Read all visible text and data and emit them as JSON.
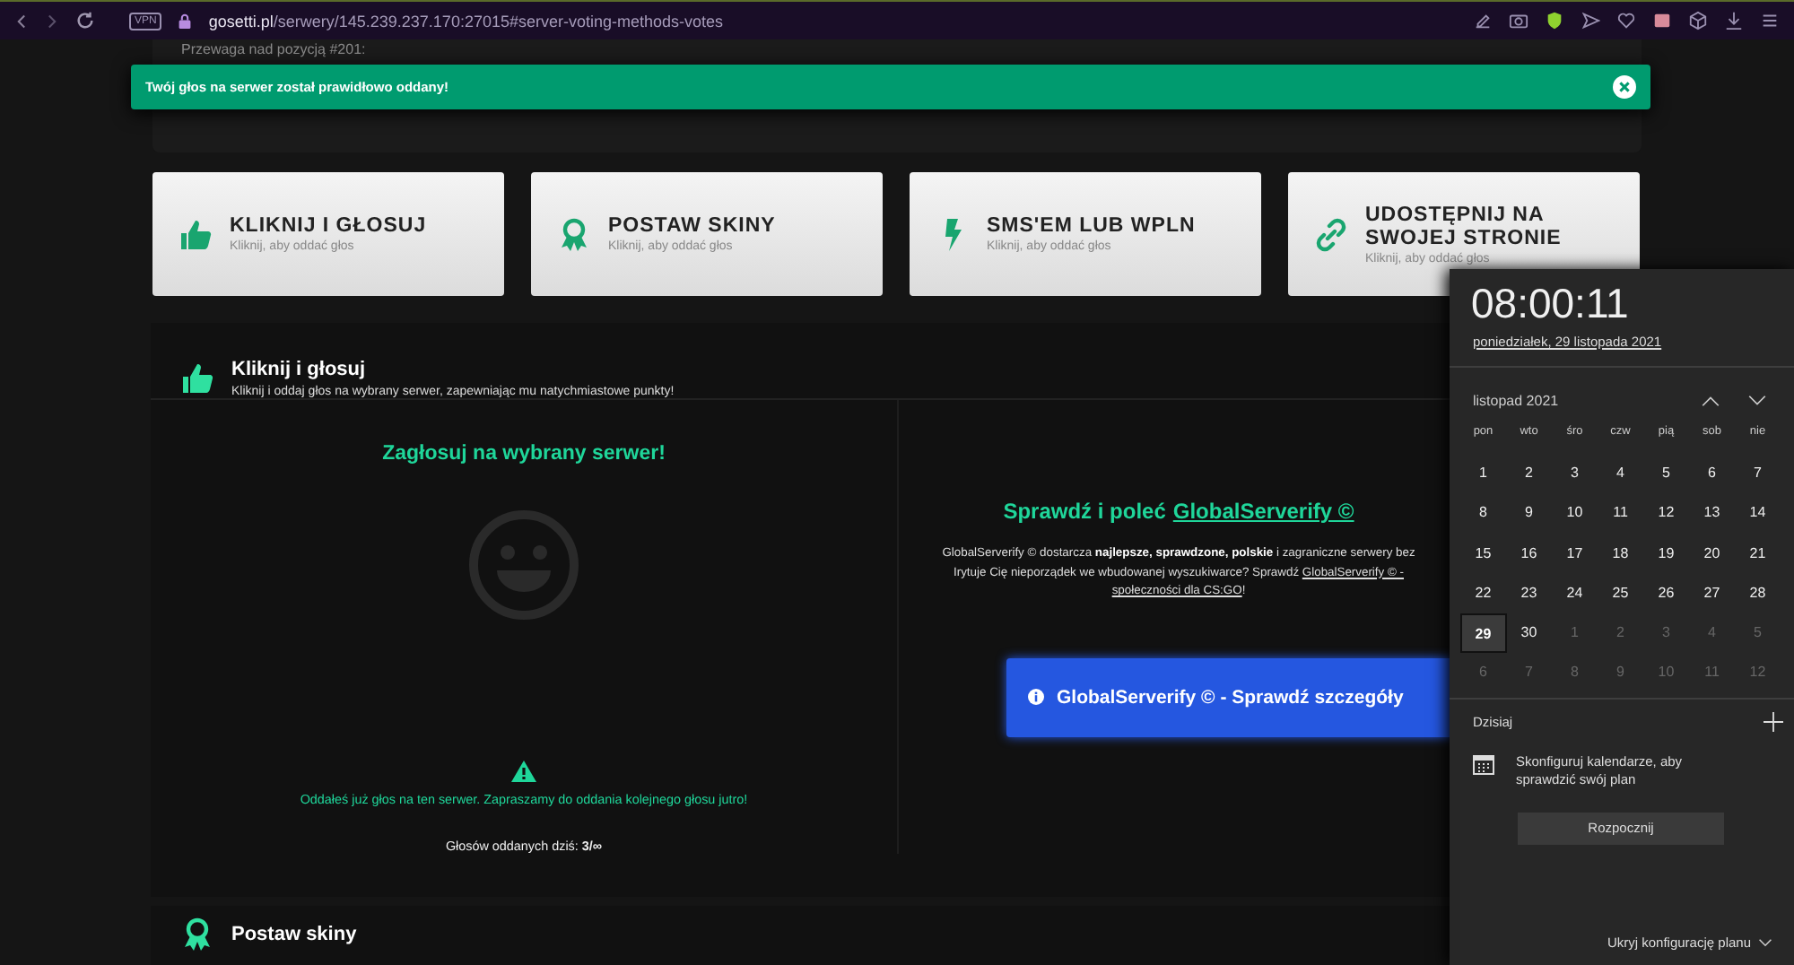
{
  "browser": {
    "vpn": "VPN",
    "url_host": "gosetti.pl",
    "url_path": "/serwery/145.239.237.170:27015#server-voting-methods-votes"
  },
  "top_card": {
    "text": "Przewaga nad pozycją #201:"
  },
  "toast": {
    "message": "Twój głos na serwer został prawidłowo oddany!"
  },
  "methods": [
    {
      "kind": "thumb",
      "title": "KLIKNIJ I GŁOSUJ",
      "subtitle": "Kliknij, aby oddać głos"
    },
    {
      "kind": "ribbon",
      "title": "POSTAW SKINY",
      "subtitle": "Kliknij, aby oddać głos"
    },
    {
      "kind": "bolt",
      "title": "SMS'EM LUB WPLN",
      "subtitle": "Kliknij, aby oddać głos"
    },
    {
      "kind": "link",
      "title": "UDOSTĘPNIJ NA SWOJEJ STRONIE",
      "subtitle": "Kliknij, aby oddać głos"
    }
  ],
  "section": {
    "kind": "thumb",
    "title": "Kliknij i głosuj",
    "subtitle": "Kliknij i oddaj głos na wybrany serwer, zapewniając mu natychmiastowe punkty!",
    "left": {
      "title": "Zagłosuj na wybrany serwer!",
      "warning": "Oddałeś już głos na ten serwer. Zapraszamy do oddania kolejnego głosu jutro!",
      "count": "Głosów oddanych dziś: **3/∞**"
    },
    "right": {
      "title_prefix": "Sprawdź i poleć",
      "title_link": "GlobalServerify ©",
      "description": [
        {
          "kind": "text",
          "text": "GlobalServerify © dostarcza **najlepsze, sprawdzone, polskie** i zagraniczne serwery bez"
        },
        {
          "kind": "break"
        },
        {
          "kind": "text",
          "text": "Irytuje Cię nieporządek we wbudowanej wyszukiwarce? Sprawdź "
        },
        {
          "kind": "link",
          "text": "GlobalServerify © -"
        },
        {
          "kind": "break"
        },
        {
          "kind": "link",
          "text": "społeczności dla CS:GO"
        },
        {
          "kind": "text",
          "text": "!"
        }
      ],
      "button": "GlobalServerify © - Sprawdź szczegóły"
    }
  },
  "next_section": {
    "kind": "ribbon",
    "title": "Postaw skiny"
  },
  "calendar": {
    "time": "08:00:11",
    "date": "poniedziałek, 29 listopada 2021",
    "month": "listopad 2021",
    "weekdays": [
      "pon",
      "wto",
      "śro",
      "czw",
      "pią",
      "sob",
      "nie"
    ],
    "weeks": [
      [
        {
          "day": "1",
          "current_month": true,
          "selected": false
        },
        {
          "day": "2",
          "current_month": true,
          "selected": false
        },
        {
          "day": "3",
          "current_month": true,
          "selected": false
        },
        {
          "day": "4",
          "current_month": true,
          "selected": false
        },
        {
          "day": "5",
          "current_month": true,
          "selected": false
        },
        {
          "day": "6",
          "current_month": true,
          "selected": false
        },
        {
          "day": "7",
          "current_month": true,
          "selected": false
        }
      ],
      [
        {
          "day": "8",
          "current_month": true,
          "selected": false
        },
        {
          "day": "9",
          "current_month": true,
          "selected": false
        },
        {
          "day": "10",
          "current_month": true,
          "selected": false
        },
        {
          "day": "11",
          "current_month": true,
          "selected": false
        },
        {
          "day": "12",
          "current_month": true,
          "selected": false
        },
        {
          "day": "13",
          "current_month": true,
          "selected": false
        },
        {
          "day": "14",
          "current_month": true,
          "selected": false
        }
      ],
      [
        {
          "day": "15",
          "current_month": true,
          "selected": false
        },
        {
          "day": "16",
          "current_month": true,
          "selected": false
        },
        {
          "day": "17",
          "current_month": true,
          "selected": false
        },
        {
          "day": "18",
          "current_month": true,
          "selected": false
        },
        {
          "day": "19",
          "current_month": true,
          "selected": false
        },
        {
          "day": "20",
          "current_month": true,
          "selected": false
        },
        {
          "day": "21",
          "current_month": true,
          "selected": false
        }
      ],
      [
        {
          "day": "22",
          "current_month": true,
          "selected": false
        },
        {
          "day": "23",
          "current_month": true,
          "selected": false
        },
        {
          "day": "24",
          "current_month": true,
          "selected": false
        },
        {
          "day": "25",
          "current_month": true,
          "selected": false
        },
        {
          "day": "26",
          "current_month": true,
          "selected": false
        },
        {
          "day": "27",
          "current_month": true,
          "selected": false
        },
        {
          "day": "28",
          "current_month": true,
          "selected": false
        }
      ],
      [
        {
          "day": "29",
          "current_month": true,
          "selected": true
        },
        {
          "day": "30",
          "current_month": true,
          "selected": false
        },
        {
          "day": "1",
          "current_month": false,
          "selected": false
        },
        {
          "day": "2",
          "current_month": false,
          "selected": false
        },
        {
          "day": "3",
          "current_month": false,
          "selected": false
        },
        {
          "day": "4",
          "current_month": false,
          "selected": false
        },
        {
          "day": "5",
          "current_month": false,
          "selected": false
        }
      ],
      [
        {
          "day": "6",
          "current_month": false,
          "selected": false
        },
        {
          "day": "7",
          "current_month": false,
          "selected": false
        },
        {
          "day": "8",
          "current_month": false,
          "selected": false
        },
        {
          "day": "9",
          "current_month": false,
          "selected": false
        },
        {
          "day": "10",
          "current_month": false,
          "selected": false
        },
        {
          "day": "11",
          "current_month": false,
          "selected": false
        },
        {
          "day": "12",
          "current_month": false,
          "selected": false
        }
      ]
    ],
    "today_label": "Dzisiaj",
    "agenda_text": "Skonfiguruj kalendarze, aby sprawdzić swój plan",
    "start_button": "Rozpocznij",
    "hide_link": "Ukryj konfigurację planu"
  }
}
